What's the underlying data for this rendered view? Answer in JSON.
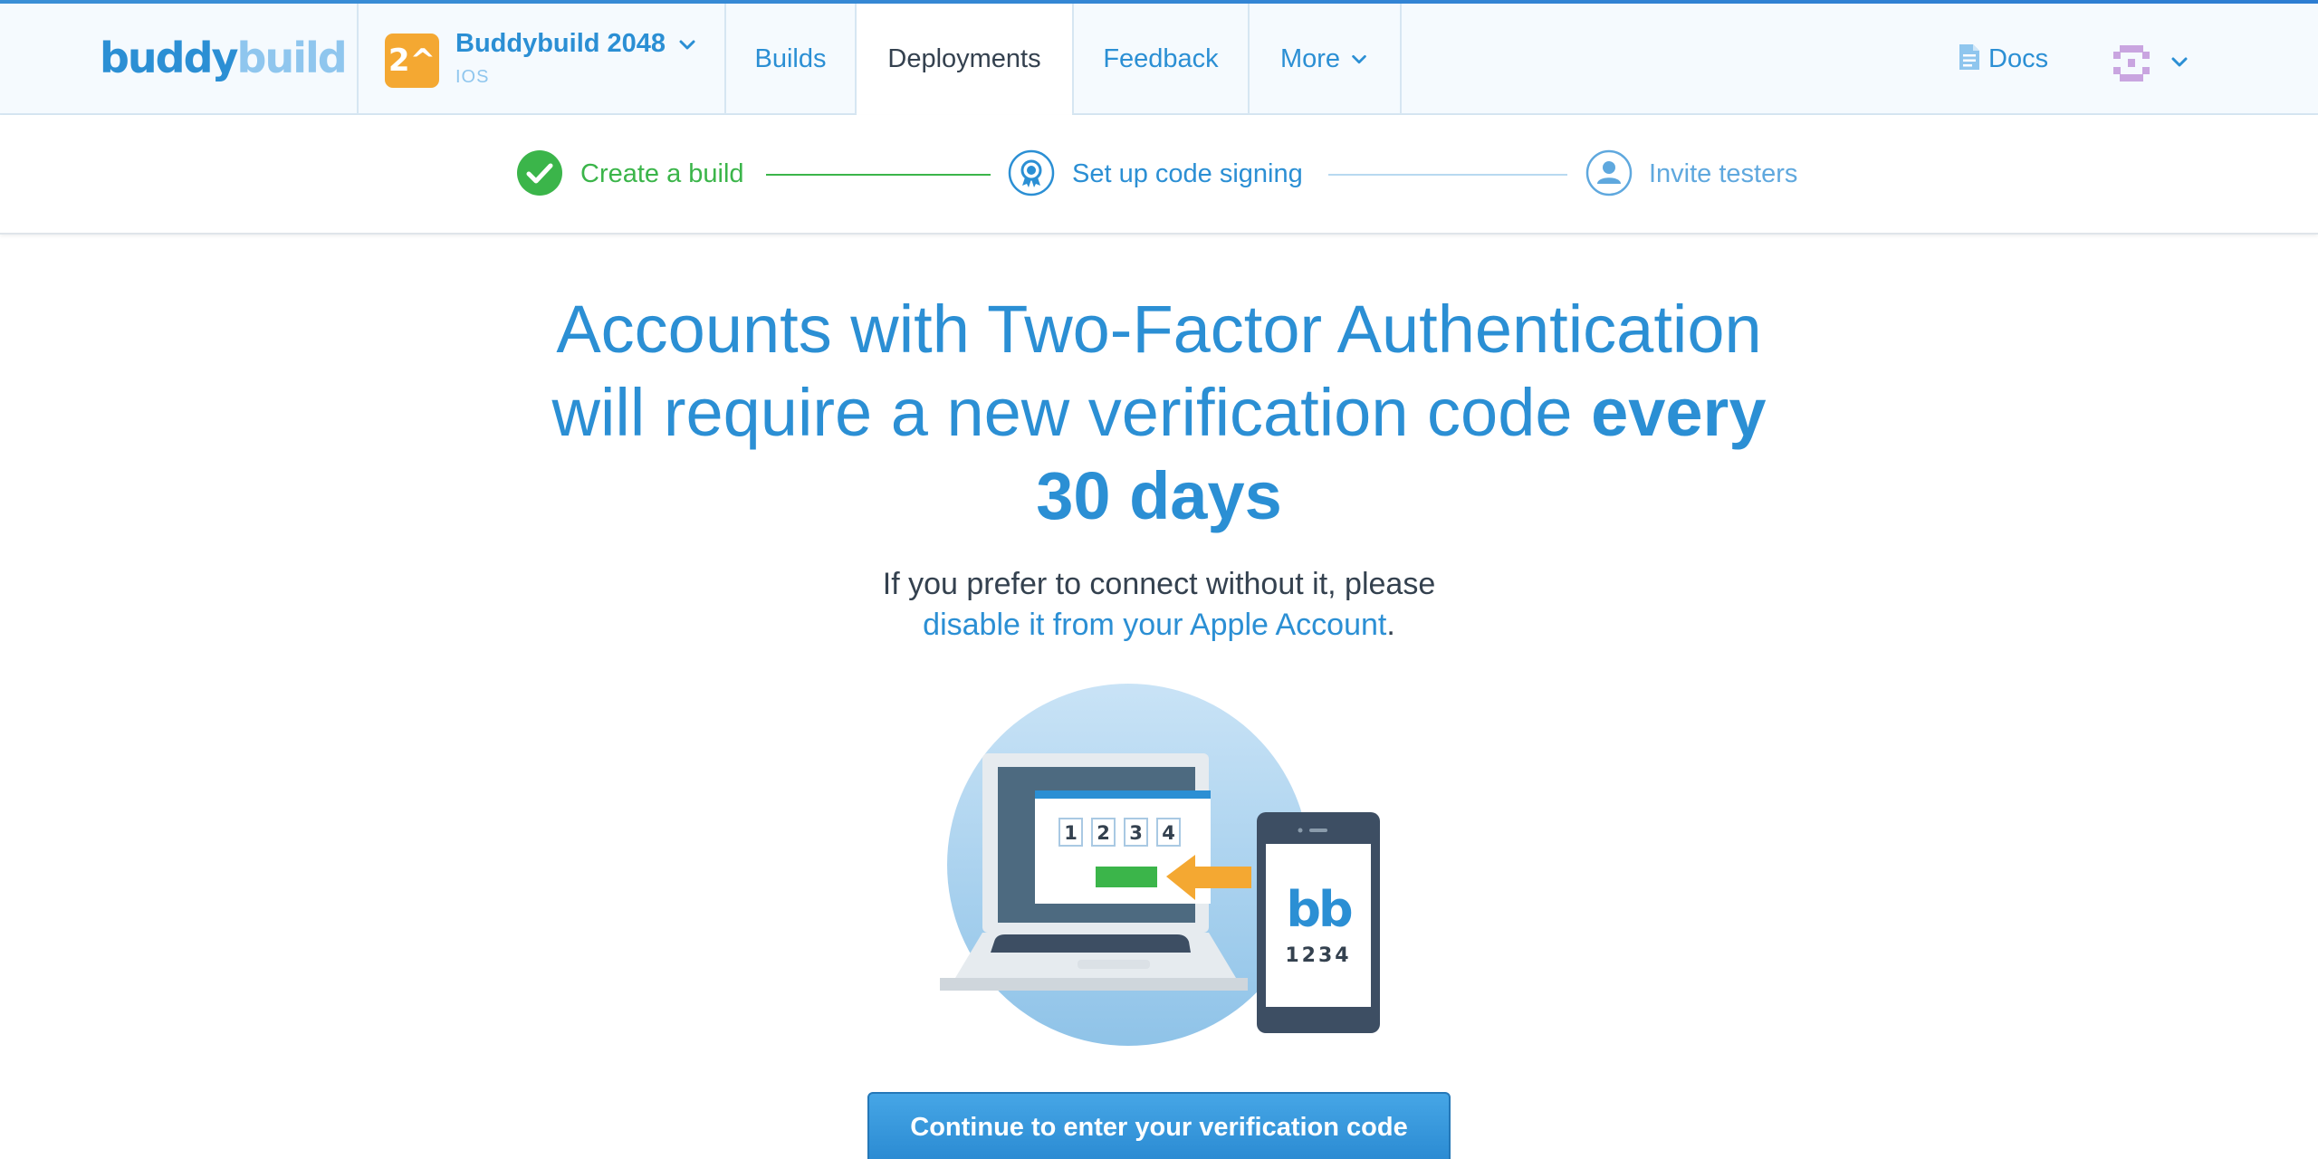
{
  "brand": {
    "logo_part1": "buddy",
    "logo_part2": "build"
  },
  "app_switcher": {
    "icon_text": "2^",
    "name": "Buddybuild 2048",
    "platform": "IOS"
  },
  "nav": {
    "tabs": [
      {
        "label": "Builds"
      },
      {
        "label": "Deployments"
      },
      {
        "label": "Feedback"
      },
      {
        "label": "More"
      }
    ],
    "docs_label": "Docs"
  },
  "stepper": {
    "steps": [
      {
        "label": "Create a build",
        "state": "complete"
      },
      {
        "label": "Set up code signing",
        "state": "current"
      },
      {
        "label": "Invite testers",
        "state": "upcoming"
      }
    ]
  },
  "main": {
    "headline_line1": "Accounts with Two-Factor Authentication",
    "headline_line2_regular": "will require a new verification code ",
    "headline_line2_bold": "every",
    "headline_line3_bold": "30 days",
    "subtext_line1": "If you prefer to connect without it, please",
    "subtext_link": "disable it from your Apple Account",
    "subtext_end": ".",
    "illustration": {
      "code_digits": [
        "1",
        "2",
        "3",
        "4"
      ],
      "phone_logo": "bb",
      "phone_code": "1234"
    },
    "cta_label": "Continue to enter your verification code"
  },
  "colors": {
    "primary": "#2b8fd4",
    "primary_light": "#8fc6ee",
    "success": "#3bb54a",
    "app_icon": "#f4a832",
    "text_dark": "#34414f"
  }
}
